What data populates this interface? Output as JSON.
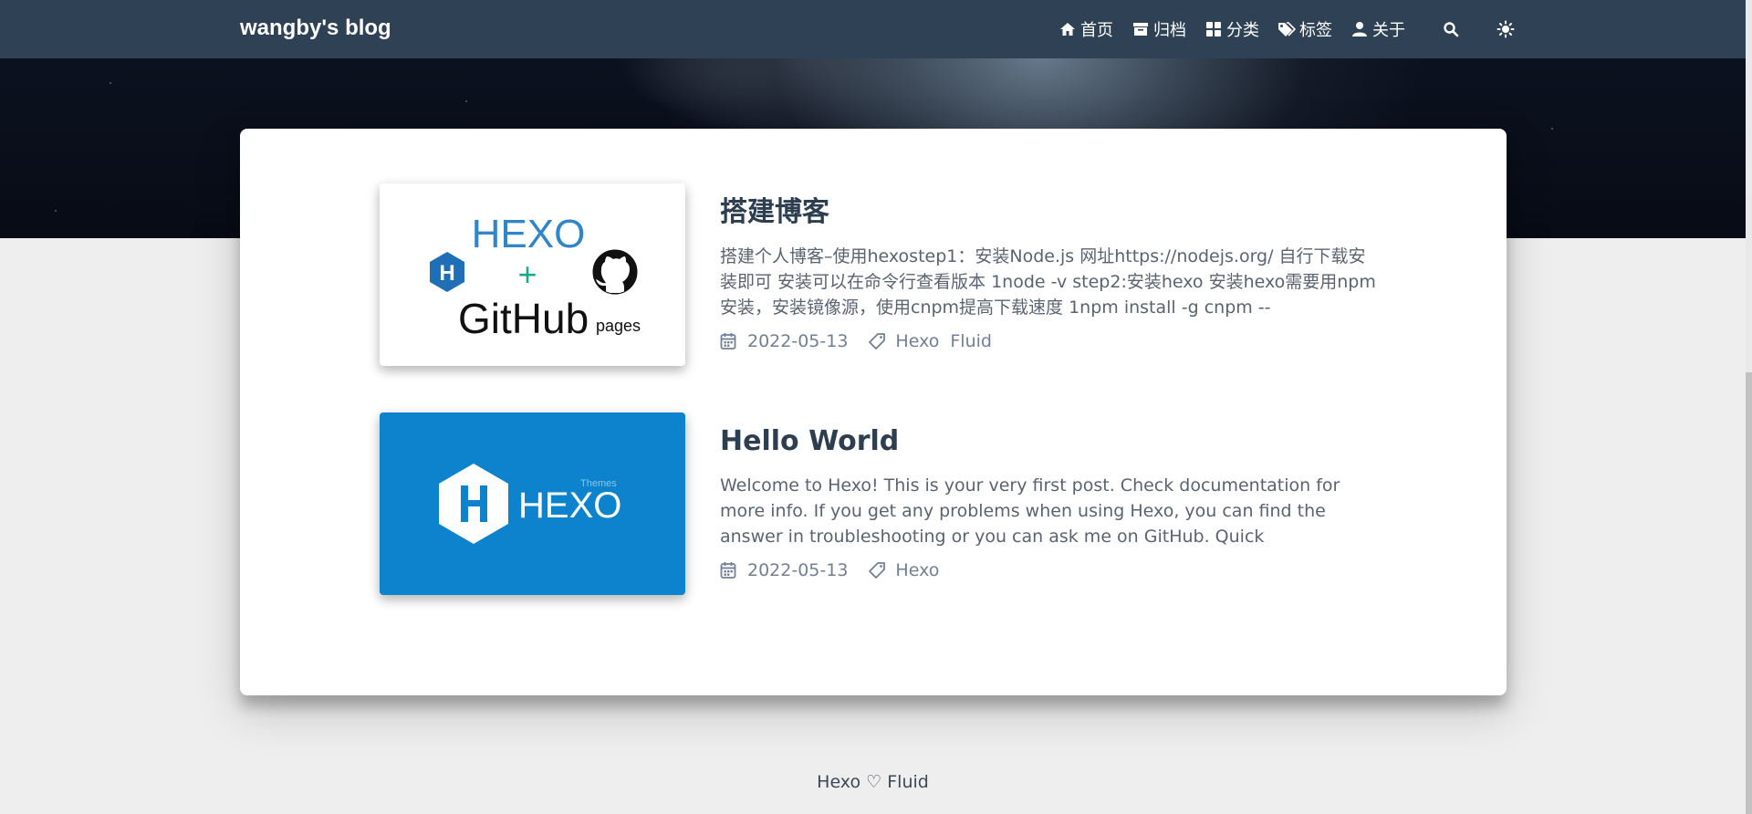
{
  "brand": "wangby's blog",
  "nav": [
    {
      "label": "首页",
      "icon": "home-icon"
    },
    {
      "label": "归档",
      "icon": "archive-icon"
    },
    {
      "label": "分类",
      "icon": "category-icon"
    },
    {
      "label": "标签",
      "icon": "tag-icon"
    },
    {
      "label": "关于",
      "icon": "user-icon"
    }
  ],
  "nav_icons": [
    "search-icon",
    "sun-icon"
  ],
  "posts": [
    {
      "title": "搭建博客",
      "excerpt": "搭建个人博客–使用hexostep1：安装Node.js 网址https://nodejs.org/ 自行下载安装即可 安装可以在命令行查看版本 1node -v step2:安装hexo 安装hexo需要用npm安装，安装镜像源，使用cnpm提高下载速度 1npm install -g cnpm --",
      "date": "2022-05-13",
      "tags": [
        "Hexo",
        "Fluid"
      ],
      "thumb": {
        "hexo": "HEXO",
        "plus": "+",
        "github": "GitHub",
        "pages": "pages"
      }
    },
    {
      "title": "Hello World",
      "excerpt": "Welcome to Hexo! This is your very first post. Check documentation for more info. If you get any problems when using Hexo, you can find the answer in troubleshooting or you can ask me on GitHub. Quick",
      "date": "2022-05-13",
      "tags": [
        "Hexo"
      ],
      "thumb": {
        "hexo": "HEXO",
        "themes": "Themes"
      }
    }
  ],
  "footer": {
    "left": "Hexo",
    "heart": "♡",
    "right": "Fluid"
  },
  "colors": {
    "navbar": "#2f4154",
    "hexo_blue": "#0e83cd",
    "background": "#eeeeee"
  }
}
